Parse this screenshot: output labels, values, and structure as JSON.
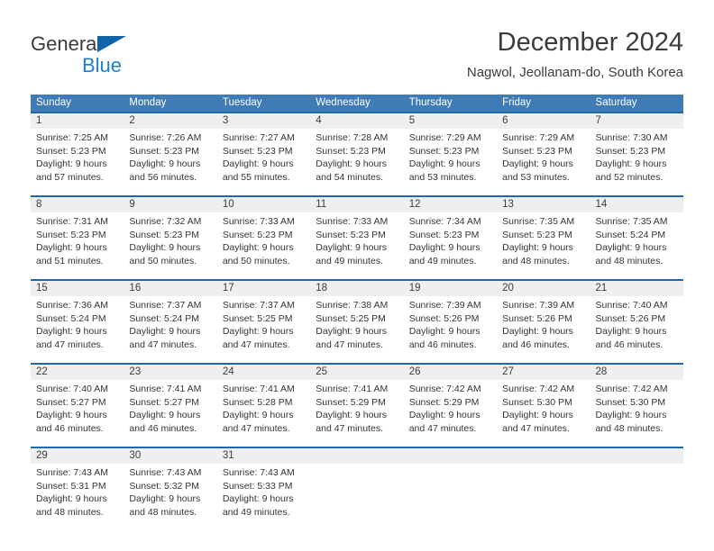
{
  "brand": {
    "name_part1": "General",
    "name_part2": "Blue",
    "color_dark": "#3b3b3b",
    "color_blue": "#1b7fd4",
    "triangle_color": "#1063a8"
  },
  "header": {
    "title": "December 2024",
    "subtitle": "Nagwol, Jeollanam-do, South Korea"
  },
  "theme": {
    "header_row_bg": "#3f7cb5",
    "week_divider": "#2167ab",
    "daynum_band_bg": "#efefef",
    "text_color": "#353535"
  },
  "weekdays": [
    "Sunday",
    "Monday",
    "Tuesday",
    "Wednesday",
    "Thursday",
    "Friday",
    "Saturday"
  ],
  "weeks": [
    [
      {
        "day": "1",
        "lines": [
          "Sunrise: 7:25 AM",
          "Sunset: 5:23 PM",
          "Daylight: 9 hours",
          "and 57 minutes."
        ]
      },
      {
        "day": "2",
        "lines": [
          "Sunrise: 7:26 AM",
          "Sunset: 5:23 PM",
          "Daylight: 9 hours",
          "and 56 minutes."
        ]
      },
      {
        "day": "3",
        "lines": [
          "Sunrise: 7:27 AM",
          "Sunset: 5:23 PM",
          "Daylight: 9 hours",
          "and 55 minutes."
        ]
      },
      {
        "day": "4",
        "lines": [
          "Sunrise: 7:28 AM",
          "Sunset: 5:23 PM",
          "Daylight: 9 hours",
          "and 54 minutes."
        ]
      },
      {
        "day": "5",
        "lines": [
          "Sunrise: 7:29 AM",
          "Sunset: 5:23 PM",
          "Daylight: 9 hours",
          "and 53 minutes."
        ]
      },
      {
        "day": "6",
        "lines": [
          "Sunrise: 7:29 AM",
          "Sunset: 5:23 PM",
          "Daylight: 9 hours",
          "and 53 minutes."
        ]
      },
      {
        "day": "7",
        "lines": [
          "Sunrise: 7:30 AM",
          "Sunset: 5:23 PM",
          "Daylight: 9 hours",
          "and 52 minutes."
        ]
      }
    ],
    [
      {
        "day": "8",
        "lines": [
          "Sunrise: 7:31 AM",
          "Sunset: 5:23 PM",
          "Daylight: 9 hours",
          "and 51 minutes."
        ]
      },
      {
        "day": "9",
        "lines": [
          "Sunrise: 7:32 AM",
          "Sunset: 5:23 PM",
          "Daylight: 9 hours",
          "and 50 minutes."
        ]
      },
      {
        "day": "10",
        "lines": [
          "Sunrise: 7:33 AM",
          "Sunset: 5:23 PM",
          "Daylight: 9 hours",
          "and 50 minutes."
        ]
      },
      {
        "day": "11",
        "lines": [
          "Sunrise: 7:33 AM",
          "Sunset: 5:23 PM",
          "Daylight: 9 hours",
          "and 49 minutes."
        ]
      },
      {
        "day": "12",
        "lines": [
          "Sunrise: 7:34 AM",
          "Sunset: 5:23 PM",
          "Daylight: 9 hours",
          "and 49 minutes."
        ]
      },
      {
        "day": "13",
        "lines": [
          "Sunrise: 7:35 AM",
          "Sunset: 5:23 PM",
          "Daylight: 9 hours",
          "and 48 minutes."
        ]
      },
      {
        "day": "14",
        "lines": [
          "Sunrise: 7:35 AM",
          "Sunset: 5:24 PM",
          "Daylight: 9 hours",
          "and 48 minutes."
        ]
      }
    ],
    [
      {
        "day": "15",
        "lines": [
          "Sunrise: 7:36 AM",
          "Sunset: 5:24 PM",
          "Daylight: 9 hours",
          "and 47 minutes."
        ]
      },
      {
        "day": "16",
        "lines": [
          "Sunrise: 7:37 AM",
          "Sunset: 5:24 PM",
          "Daylight: 9 hours",
          "and 47 minutes."
        ]
      },
      {
        "day": "17",
        "lines": [
          "Sunrise: 7:37 AM",
          "Sunset: 5:25 PM",
          "Daylight: 9 hours",
          "and 47 minutes."
        ]
      },
      {
        "day": "18",
        "lines": [
          "Sunrise: 7:38 AM",
          "Sunset: 5:25 PM",
          "Daylight: 9 hours",
          "and 47 minutes."
        ]
      },
      {
        "day": "19",
        "lines": [
          "Sunrise: 7:39 AM",
          "Sunset: 5:26 PM",
          "Daylight: 9 hours",
          "and 46 minutes."
        ]
      },
      {
        "day": "20",
        "lines": [
          "Sunrise: 7:39 AM",
          "Sunset: 5:26 PM",
          "Daylight: 9 hours",
          "and 46 minutes."
        ]
      },
      {
        "day": "21",
        "lines": [
          "Sunrise: 7:40 AM",
          "Sunset: 5:26 PM",
          "Daylight: 9 hours",
          "and 46 minutes."
        ]
      }
    ],
    [
      {
        "day": "22",
        "lines": [
          "Sunrise: 7:40 AM",
          "Sunset: 5:27 PM",
          "Daylight: 9 hours",
          "and 46 minutes."
        ]
      },
      {
        "day": "23",
        "lines": [
          "Sunrise: 7:41 AM",
          "Sunset: 5:27 PM",
          "Daylight: 9 hours",
          "and 46 minutes."
        ]
      },
      {
        "day": "24",
        "lines": [
          "Sunrise: 7:41 AM",
          "Sunset: 5:28 PM",
          "Daylight: 9 hours",
          "and 47 minutes."
        ]
      },
      {
        "day": "25",
        "lines": [
          "Sunrise: 7:41 AM",
          "Sunset: 5:29 PM",
          "Daylight: 9 hours",
          "and 47 minutes."
        ]
      },
      {
        "day": "26",
        "lines": [
          "Sunrise: 7:42 AM",
          "Sunset: 5:29 PM",
          "Daylight: 9 hours",
          "and 47 minutes."
        ]
      },
      {
        "day": "27",
        "lines": [
          "Sunrise: 7:42 AM",
          "Sunset: 5:30 PM",
          "Daylight: 9 hours",
          "and 47 minutes."
        ]
      },
      {
        "day": "28",
        "lines": [
          "Sunrise: 7:42 AM",
          "Sunset: 5:30 PM",
          "Daylight: 9 hours",
          "and 48 minutes."
        ]
      }
    ],
    [
      {
        "day": "29",
        "lines": [
          "Sunrise: 7:43 AM",
          "Sunset: 5:31 PM",
          "Daylight: 9 hours",
          "and 48 minutes."
        ]
      },
      {
        "day": "30",
        "lines": [
          "Sunrise: 7:43 AM",
          "Sunset: 5:32 PM",
          "Daylight: 9 hours",
          "and 48 minutes."
        ]
      },
      {
        "day": "31",
        "lines": [
          "Sunrise: 7:43 AM",
          "Sunset: 5:33 PM",
          "Daylight: 9 hours",
          "and 49 minutes."
        ]
      },
      {
        "day": "",
        "lines": []
      },
      {
        "day": "",
        "lines": []
      },
      {
        "day": "",
        "lines": []
      },
      {
        "day": "",
        "lines": []
      }
    ]
  ]
}
